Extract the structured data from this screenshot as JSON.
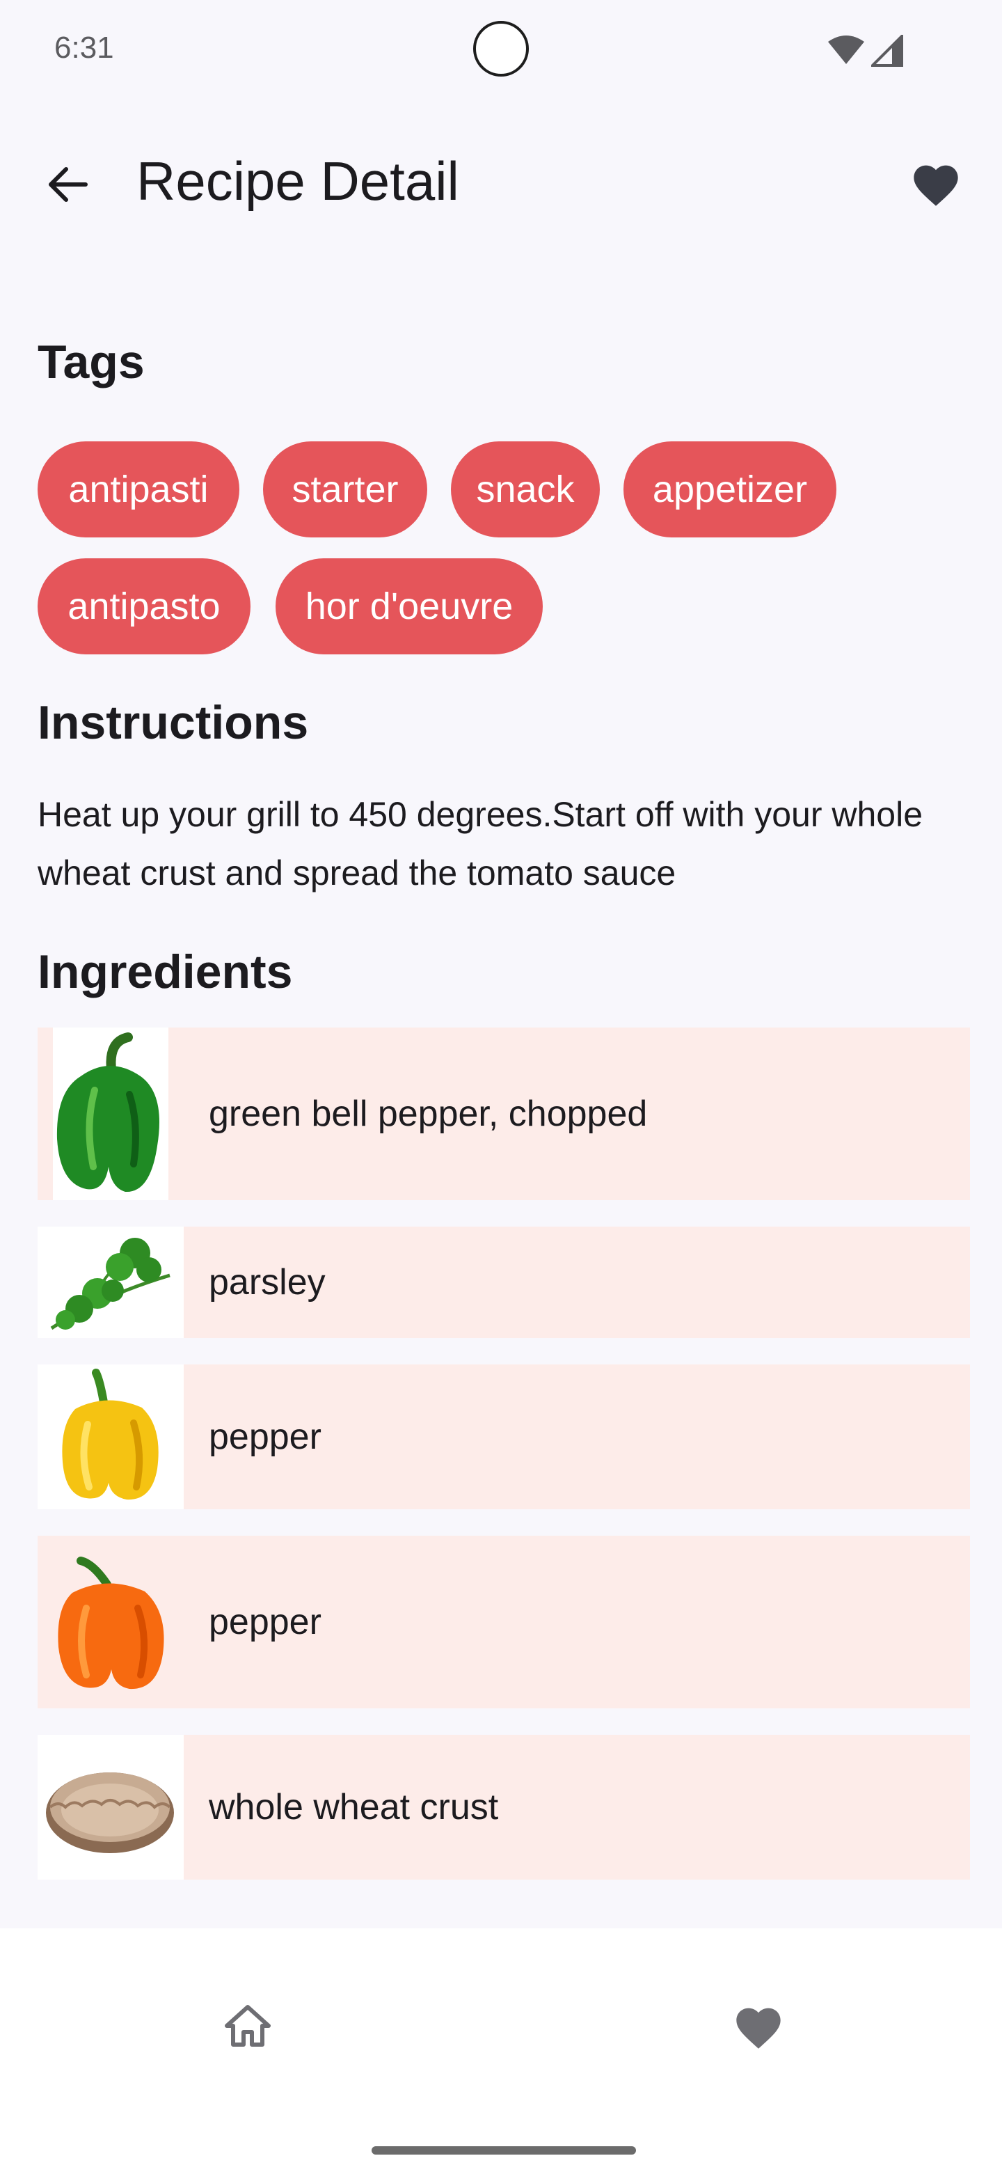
{
  "status_bar": {
    "time": "6:31",
    "icons": [
      "wifi-icon",
      "signal-icon"
    ]
  },
  "app_bar": {
    "title": "Recipe Detail",
    "back_icon": "arrow-back-icon",
    "favorite_icon": "heart-icon"
  },
  "tags": {
    "heading": "Tags",
    "items": [
      "antipasti",
      "starter",
      "snack",
      "appetizer",
      "antipasto",
      "hor d'oeuvre"
    ]
  },
  "instructions": {
    "heading": "Instructions",
    "text": "Heat up your grill to 450 degrees.Start off with your whole wheat crust and spread the tomato sauce"
  },
  "ingredients": {
    "heading": "Ingredients",
    "items": [
      {
        "name": "green bell pepper, chopped",
        "image": "green-bell-pepper"
      },
      {
        "name": "parsley",
        "image": "parsley"
      },
      {
        "name": "pepper",
        "image": "yellow-pepper"
      },
      {
        "name": "pepper",
        "image": "orange-pepper"
      },
      {
        "name": "whole wheat crust",
        "image": "pie-crust"
      }
    ]
  },
  "bottom_nav": {
    "items": [
      {
        "icon": "home-icon"
      },
      {
        "icon": "heart-icon"
      }
    ]
  },
  "colors": {
    "background": "#f8f7fc",
    "chip": "#e5555a",
    "ingredient_row": "#fdece9",
    "icon_dark": "#3a3d47"
  }
}
